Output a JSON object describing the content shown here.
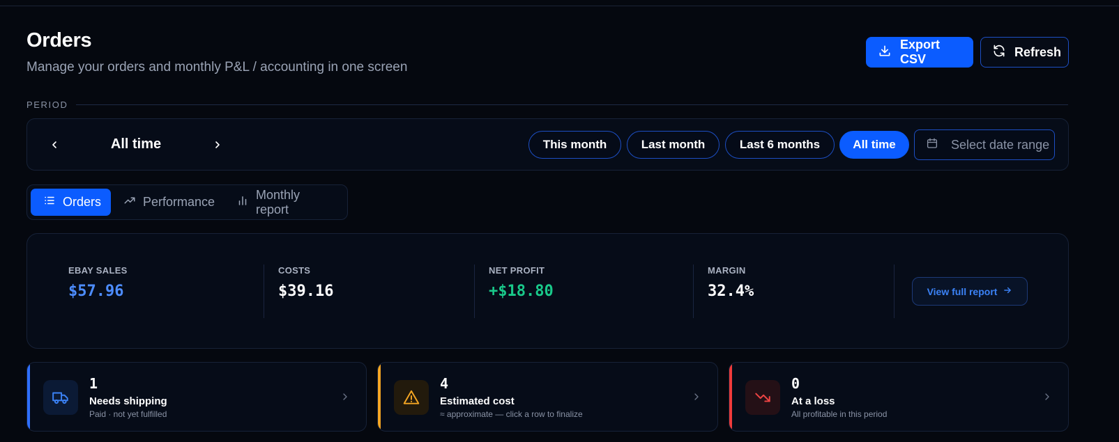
{
  "header": {
    "title": "Orders",
    "subtitle": "Manage your orders and monthly P&L / accounting in one screen",
    "export_label": "Export CSV",
    "refresh_label": "Refresh"
  },
  "period": {
    "section_label": "PERIOD",
    "current": "All time",
    "presets": [
      "This month",
      "Last month",
      "Last 6 months",
      "All time"
    ],
    "active_preset": "All time",
    "date_range_placeholder": "Select date range"
  },
  "tabs": [
    {
      "label": "Orders",
      "icon": "list-icon",
      "active": true
    },
    {
      "label": "Performance",
      "icon": "trending-up-icon",
      "active": false
    },
    {
      "label": "Monthly report",
      "icon": "bar-chart-icon",
      "active": false
    }
  ],
  "summary": {
    "ebay_sales": {
      "label": "EBAY SALES",
      "value": "$57.96",
      "color": "#4d8dff"
    },
    "costs": {
      "label": "COSTS",
      "value": "$39.16",
      "color": "#ffffff"
    },
    "net_profit": {
      "label": "NET PROFIT",
      "value": "+$18.80",
      "color": "#19c98a"
    },
    "margin": {
      "label": "MARGIN",
      "value": "32.4%",
      "color": "#ffffff"
    },
    "view_report_label": "View full report"
  },
  "status_cards": [
    {
      "count": "1",
      "title": "Needs shipping",
      "subtitle": "Paid · not yet fulfilled",
      "icon": "truck-icon",
      "accent": "#2f6fff"
    },
    {
      "count": "4",
      "title": "Estimated cost",
      "subtitle": "≈ approximate — click a row to finalize",
      "icon": "warning-icon",
      "accent": "#f5a623"
    },
    {
      "count": "0",
      "title": "At a loss",
      "subtitle": "All profitable in this period",
      "icon": "trending-down-icon",
      "accent": "#ef3b3b"
    }
  ]
}
